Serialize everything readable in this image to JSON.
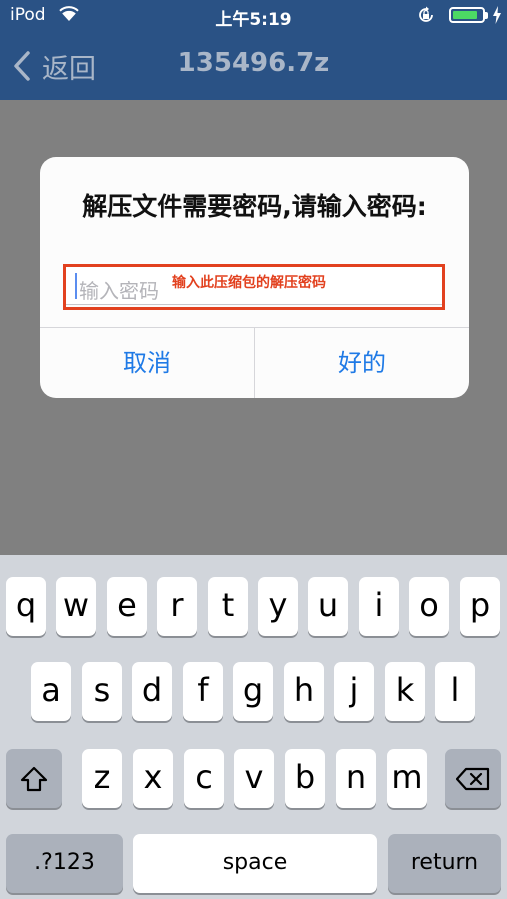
{
  "status_bar": {
    "carrier": "iPod",
    "time": "上午5:19",
    "battery_level": 0.85
  },
  "nav": {
    "back_label": "返回",
    "title": "135496.7z"
  },
  "alert": {
    "message": "解压文件需要密码,请输入密码:",
    "input_placeholder": "输入密码",
    "cancel_label": "取消",
    "ok_label": "好的"
  },
  "annotation": {
    "text": "输入此压缩包的解压密码",
    "color": "#e2411f"
  },
  "keyboard": {
    "row1": [
      "q",
      "w",
      "e",
      "r",
      "t",
      "y",
      "u",
      "i",
      "o",
      "p"
    ],
    "row2": [
      "a",
      "s",
      "d",
      "f",
      "g",
      "h",
      "j",
      "k",
      "l"
    ],
    "row3": [
      "z",
      "x",
      "c",
      "v",
      "b",
      "n",
      "m"
    ],
    "mode_label": ".?123",
    "space_label": "space",
    "return_label": "return"
  },
  "icons": [
    "wifi-icon",
    "orientation-lock-icon",
    "battery-icon",
    "charging-bolt-icon",
    "back-chevron-icon",
    "shift-icon",
    "delete-icon"
  ],
  "colors": {
    "nav_bar": "#2a5285",
    "alert_button": "#1f7ae6",
    "keyboard": "#d1d5db"
  }
}
